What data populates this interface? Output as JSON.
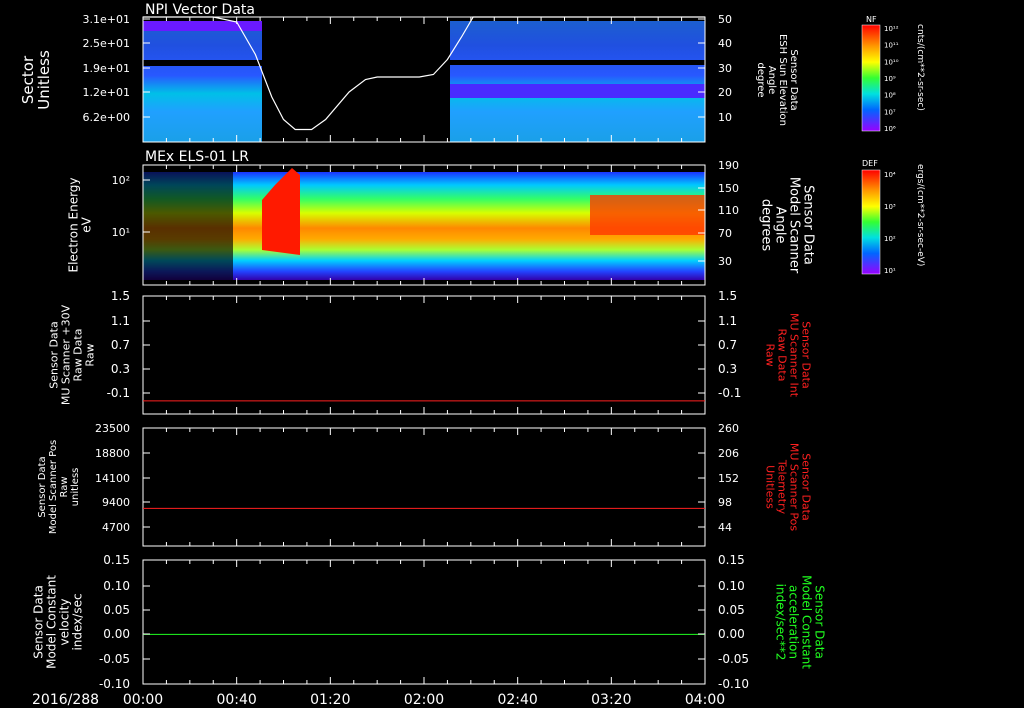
{
  "colors": {
    "white": "#ffffff",
    "red": "#ff2020",
    "green": "#20ff20",
    "background": "#000000"
  },
  "chart_data": [
    {
      "type": "heatmap",
      "title": "NPI Vector Data",
      "ylabel": "Sector\nUnitless",
      "yticks": [
        "3.1e+01",
        "2.5e+01",
        "1.9e+01",
        "1.2e+01",
        "6.2e+00"
      ],
      "y2label": "Sensor Data\nESH Sun Elevation\nAngle\ndegree",
      "y2ticks": [
        "50",
        "40",
        "30",
        "20",
        "10"
      ],
      "y2lim": [
        0,
        50
      ],
      "overlay_line": {
        "color": "white",
        "points": [
          [
            0,
            50
          ],
          [
            10,
            50
          ],
          [
            30,
            50
          ],
          [
            40,
            48
          ],
          [
            48,
            35
          ],
          [
            55,
            18
          ],
          [
            60,
            9
          ],
          [
            65,
            5
          ],
          [
            72,
            5
          ],
          [
            78,
            9
          ],
          [
            88,
            20
          ],
          [
            95,
            25
          ],
          [
            100,
            26
          ],
          [
            118,
            26
          ],
          [
            124,
            27
          ],
          [
            130,
            33
          ],
          [
            136,
            42
          ],
          [
            141,
            50
          ],
          [
            150,
            50
          ],
          [
            240,
            50
          ]
        ]
      },
      "data_gap_minutes": [
        43,
        108
      ],
      "colorbar": {
        "label": "NF",
        "units": "cnts/(cm**2-sr-sec)",
        "ticks": [
          "10¹²",
          "10¹¹",
          "10¹⁰",
          "10⁹",
          "10⁸",
          "10⁷",
          "10⁶"
        ]
      }
    },
    {
      "type": "heatmap",
      "title": "MEx ELS-01 LR",
      "ylabel": "Electron Energy\neV",
      "yticks": [
        "10²",
        "10¹"
      ],
      "y2label": "Sensor Data\nModel Scanner\nAngle\ndegrees",
      "y2ticks": [
        "190",
        "150",
        "110",
        "70",
        "30"
      ],
      "colorbar": {
        "label": "DEF",
        "units": "ergs/(cm**2-sr-sec-eV)",
        "ticks": [
          "10⁴",
          "10³",
          "10²",
          "10¹"
        ]
      }
    },
    {
      "type": "line",
      "ylabel": "Sensor Data\nMU Scanner +30V\nRaw Data\nRaw",
      "yticks": [
        "1.5",
        "1.1",
        "0.7",
        "0.3",
        "-0.1"
      ],
      "y2label": "Sensor Data\nMU Scanner Int\nRaw Data\nRaw",
      "y2ticks": [
        "1.5",
        "1.1",
        "0.7",
        "0.3",
        "-0.1"
      ],
      "ylim": [
        -0.3,
        1.5
      ],
      "series": [
        {
          "color": "red",
          "x": [
            0,
            240
          ],
          "y": [
            -0.1,
            -0.1
          ]
        }
      ]
    },
    {
      "type": "line",
      "ylabel": "Sensor Data\nModel Scanner Pos\nRaw\nunitless",
      "yticks": [
        "23500",
        "18800",
        "14100",
        "9400",
        "4700"
      ],
      "y2label": "Sensor Data\nMU Scanner Pos\nTelemetry\nUnitless",
      "y2ticks": [
        "260",
        "206",
        "152",
        "98",
        "44"
      ],
      "ylim": [
        0,
        23500
      ],
      "series": [
        {
          "color": "red",
          "x": [
            0,
            240
          ],
          "y": [
            7500,
            7500
          ]
        }
      ]
    },
    {
      "type": "line",
      "ylabel": "Sensor Data\nModel Constant\nvelocity\nindex/sec",
      "yticks": [
        "0.15",
        "0.10",
        "0.05",
        "0.00",
        "-0.05",
        "-0.10"
      ],
      "y2label": "Sensor Data\nModel Constant\nacceleration\nindex/sec**2",
      "y2ticks": [
        "0.15",
        "0.10",
        "0.05",
        "0.00",
        "-0.05",
        "-0.10"
      ],
      "ylim": [
        -0.1,
        0.15
      ],
      "series": [
        {
          "color": "green",
          "x": [
            0,
            240
          ],
          "y": [
            0,
            0
          ]
        }
      ]
    }
  ],
  "xaxis": {
    "date": "2016/288",
    "ticks": [
      "00:00",
      "00:40",
      "01:20",
      "02:00",
      "02:40",
      "03:20",
      "04:00"
    ],
    "xlim_minutes": [
      0,
      240
    ]
  }
}
